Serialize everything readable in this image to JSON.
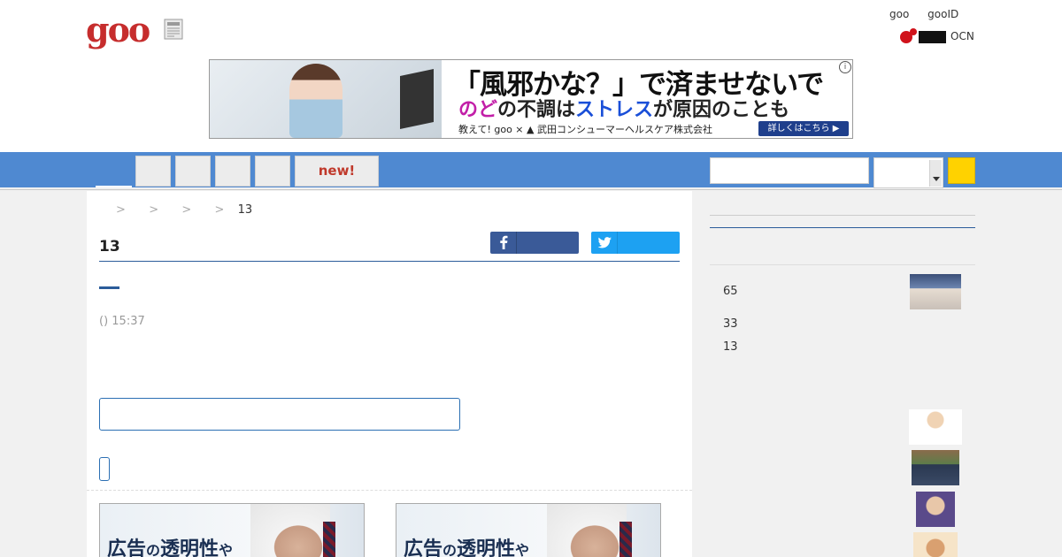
{
  "header": {
    "logo": "goo",
    "links": [
      "goo",
      "gooID"
    ],
    "ocn_label": "OCN"
  },
  "ad_banner": {
    "headline": "「風邪かな？」で済ませないで",
    "sub_part1": "のど",
    "sub_part2": "の不調は",
    "sub_part3": "ストレス",
    "sub_part4": "が原因のことも",
    "footer": "教えて! goo × ▲ 武田コンシューマーヘルスケア株式会社",
    "button": "詳しくはこちら ▶",
    "info": "i"
  },
  "nav": {
    "new_label": "new!"
  },
  "article": {
    "breadcrumb_sep": ">",
    "breadcrumb_current": "13",
    "title": "13",
    "timestamp": "() 15:37"
  },
  "ads": {
    "card_text_big1": "広告",
    "card_text_small": "の",
    "card_text_big2": "透明性",
    "card_text_tail": "や"
  },
  "sidebar": {
    "rank1": "65",
    "rank2": "33",
    "rank3": "13"
  },
  "colors": {
    "nav_blue": "#4f89d1",
    "logo_red": "#c62d2d",
    "facebook": "#3a5a98",
    "twitter": "#1da1f2",
    "search_button": "#ffd200"
  }
}
